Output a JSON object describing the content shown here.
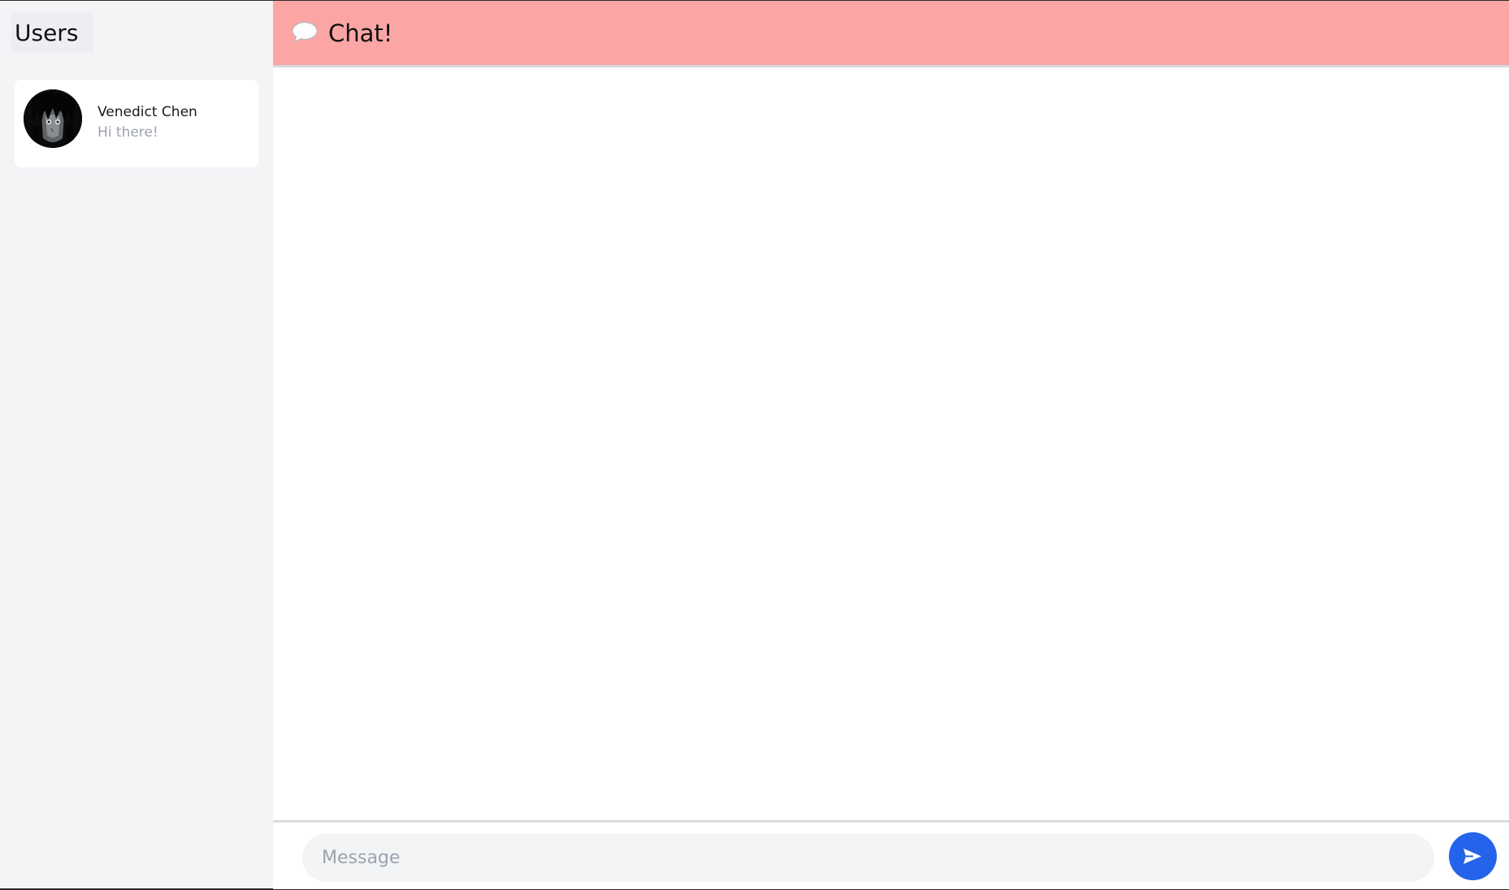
{
  "sidebar": {
    "title": "Users",
    "users": [
      {
        "name": "Venedict Chen",
        "last_message": "Hi there!",
        "avatar": "anime-character-avatar"
      }
    ]
  },
  "header": {
    "icon": "chat-bubble-icon",
    "title": "Chat!",
    "background_color": "#fca5a5"
  },
  "composer": {
    "placeholder": "Message",
    "value": "",
    "send_icon": "send-icon",
    "send_color": "#2563eb"
  }
}
